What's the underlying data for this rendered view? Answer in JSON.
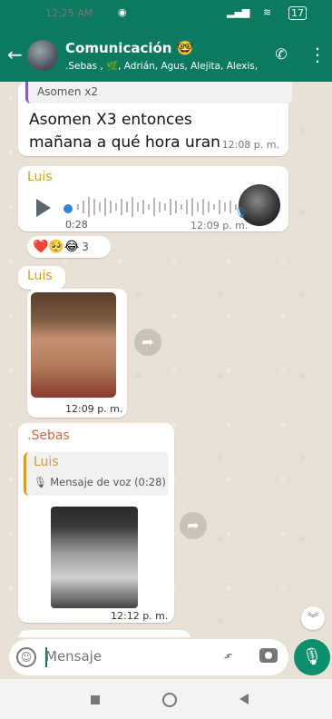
{
  "status_bar": {
    "time": "12:25 AM",
    "battery": "17"
  },
  "header": {
    "title": "Comunicación 🤓",
    "members": ".Sebas , 🌿, Adrián, Agus, Alejita, Alexis, ..."
  },
  "messages": {
    "m1": {
      "quoted": "Asomen x2",
      "text": "Asomen X3 entonces mañana a qué hora uran",
      "time": "12:08 p. m."
    },
    "m2": {
      "sender": "Luis",
      "duration": "0:28",
      "time": "12:09 p. m.",
      "reactions": "❤️🥺😂",
      "reaction_count": "3"
    },
    "m3": {
      "sender": "Luis"
    },
    "m4": {
      "time": "12:09 p. m."
    },
    "m5": {
      "sender": ".Sebas",
      "quoted_sender": "Luis",
      "quoted_text": "🎙 Mensaje de voz (0:28)",
      "time": "12:12 p. m."
    }
  },
  "composer": {
    "placeholder": "Mensaje"
  },
  "icons": [
    "back-arrow-icon",
    "add-call-icon",
    "kebab-menu-icon",
    "play-icon",
    "mic-mini-icon",
    "forward-icon",
    "scroll-down-icon",
    "emoji-icon",
    "attach-icon",
    "camera-icon",
    "mic-icon",
    "nav-recent-icon",
    "nav-home-icon",
    "nav-back-icon"
  ],
  "colors": {
    "header": "#0b7a60",
    "accent": "#0b8f6c",
    "sender_luis": "#d4a023",
    "sender_sebas": "#d9643a",
    "voice_dot": "#2a86d6"
  }
}
